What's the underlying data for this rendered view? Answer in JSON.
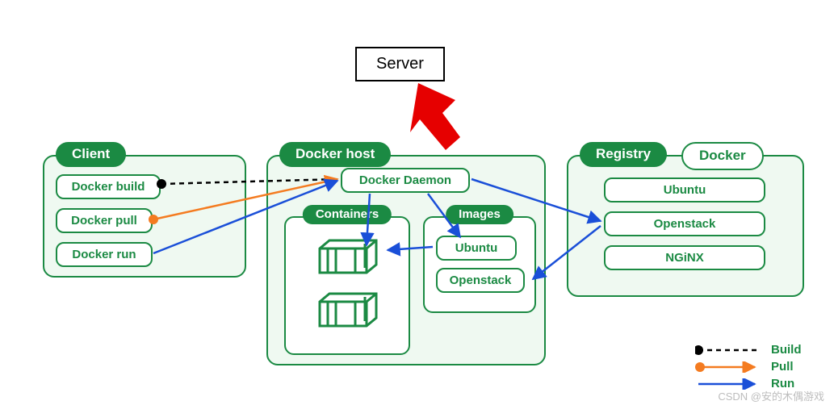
{
  "annotation": {
    "server": "Server"
  },
  "client": {
    "title": "Client",
    "items": [
      "Docker build",
      "Docker pull",
      "Docker run"
    ]
  },
  "host": {
    "title": "Docker host",
    "daemon": "Docker Daemon",
    "containers": {
      "title": "Containers"
    },
    "images": {
      "title": "Images",
      "items": [
        "Ubuntu",
        "Openstack"
      ]
    }
  },
  "registry": {
    "title": "Registry",
    "brand": "Docker",
    "items": [
      "Ubuntu",
      "Openstack",
      "NGiNX"
    ]
  },
  "legend": {
    "build": "Build",
    "pull": "Pull",
    "run": "Run"
  },
  "watermark": "CSDN @安的木偶游戏",
  "colors": {
    "green": "#1b8a43",
    "orange": "#f47b20",
    "blue": "#1a4fd8",
    "red": "#e60000"
  }
}
